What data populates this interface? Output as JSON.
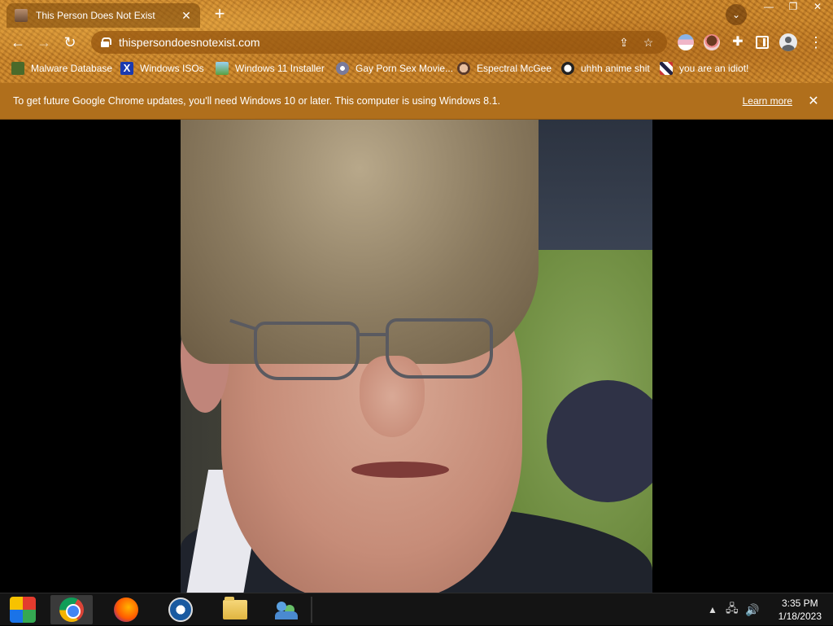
{
  "browser": {
    "tab": {
      "title": "This Person Does Not Exist",
      "close": "✕"
    },
    "new_tab": "+",
    "tab_search": "⌄",
    "window_controls": {
      "minimize": "—",
      "restore": "❐",
      "close": "✕"
    },
    "nav": {
      "back": "←",
      "forward": "→",
      "reload": "↻"
    },
    "omnibox": {
      "url": "thispersondoesnotexist.com",
      "share_icon": "⇪",
      "bookmark_star": "☆"
    },
    "extensions_icon": "✚",
    "menu": "⋮",
    "bookmarks": [
      {
        "label": "Malware Database",
        "icon": "malware-icon"
      },
      {
        "label": "Windows ISOs",
        "icon": "x-icon",
        "glyph": "X"
      },
      {
        "label": "Windows 11 Installer",
        "icon": "installer-icon"
      },
      {
        "label": "Gay Porn Sex Movie...",
        "icon": "disc-icon"
      },
      {
        "label": "Espectral McGee",
        "icon": "mcgee-icon"
      },
      {
        "label": "uhhh anime shit",
        "icon": "anime-icon"
      },
      {
        "label": "you are an idiot!",
        "icon": "flag-icon"
      }
    ]
  },
  "infobar": {
    "message": "To get future Google Chrome updates, you'll need Windows 10 or later. This computer is using Windows 8.1.",
    "link": "Learn more",
    "close": "✕"
  },
  "taskbar": {
    "items": [
      "start",
      "chrome",
      "firefox",
      "obama",
      "file-explorer",
      "users"
    ],
    "active": "chrome",
    "tray": {
      "chevron": "▲",
      "network": "🖧",
      "volume": "🔊"
    },
    "clock": {
      "time": "3:35 PM",
      "date": "1/18/2023"
    }
  }
}
